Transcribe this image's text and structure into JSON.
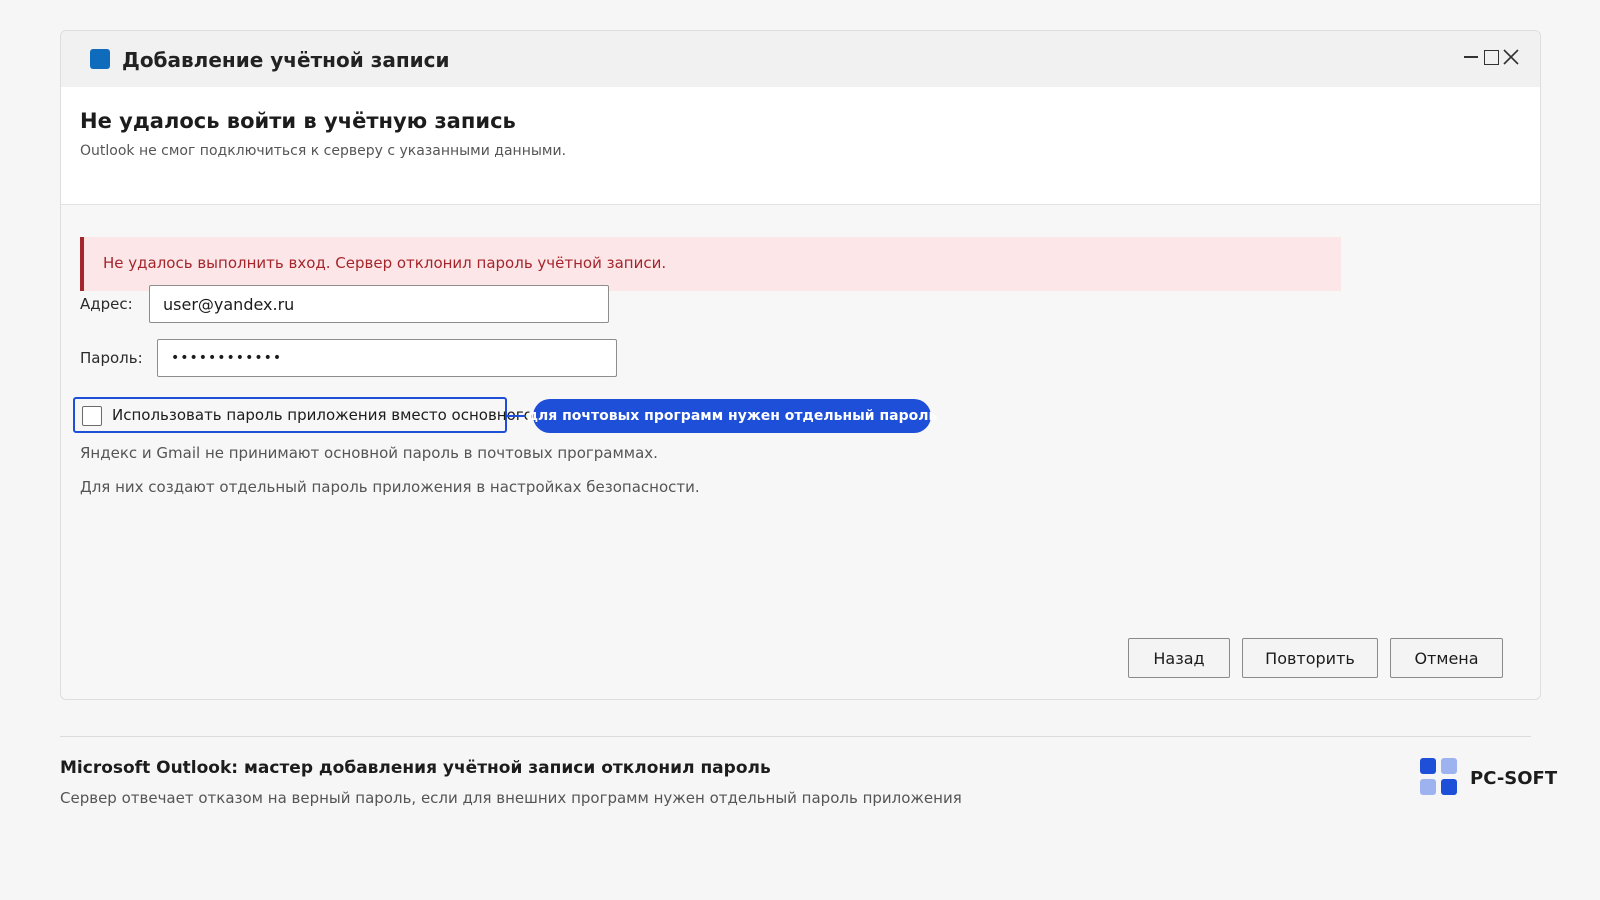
{
  "window": {
    "title": "Добавление учётной записи",
    "controls": [
      "minimize-icon",
      "maximize-icon",
      "close-icon"
    ]
  },
  "header": {
    "title": "Не удалось войти в учётную запись",
    "subtitle": "Outlook не смог подключиться к серверу с указанными данными."
  },
  "error": {
    "message": "Не удалось выполнить вход. Сервер отклонил пароль учётной записи."
  },
  "form": {
    "address_label": "Адрес:",
    "address_value": "user@yandex.ru",
    "password_label": "Пароль:",
    "password_value": "••••••••••••",
    "app_password_checkbox_label": "Использовать пароль приложения вместо основного",
    "app_password_checked": false
  },
  "callout": {
    "text": "для почтовых программ нужен отдельный пароль"
  },
  "help": {
    "line1": "Яндекс и Gmail не принимают основной пароль в почтовых программах.",
    "line2": "Для них создают отдельный пароль приложения в настройках безопасности."
  },
  "buttons": {
    "back": "Назад",
    "retry": "Повторить",
    "cancel": "Отмена"
  },
  "caption": {
    "title": "Microsoft Outlook: мастер добавления учётной записи отклонил пароль",
    "subtitle": "Сервер отвечает отказом на верный пароль, если для внешних программ нужен отдельный пароль приложения"
  },
  "brand": {
    "name": "PC-SOFT",
    "color_dark": "#1e4fd8",
    "color_light": "#9db3f0"
  },
  "colors": {
    "accent": "#0f6cbd",
    "error_text": "#a4262c",
    "error_bg": "#fde6e8",
    "callout": "#1e4fd8"
  }
}
